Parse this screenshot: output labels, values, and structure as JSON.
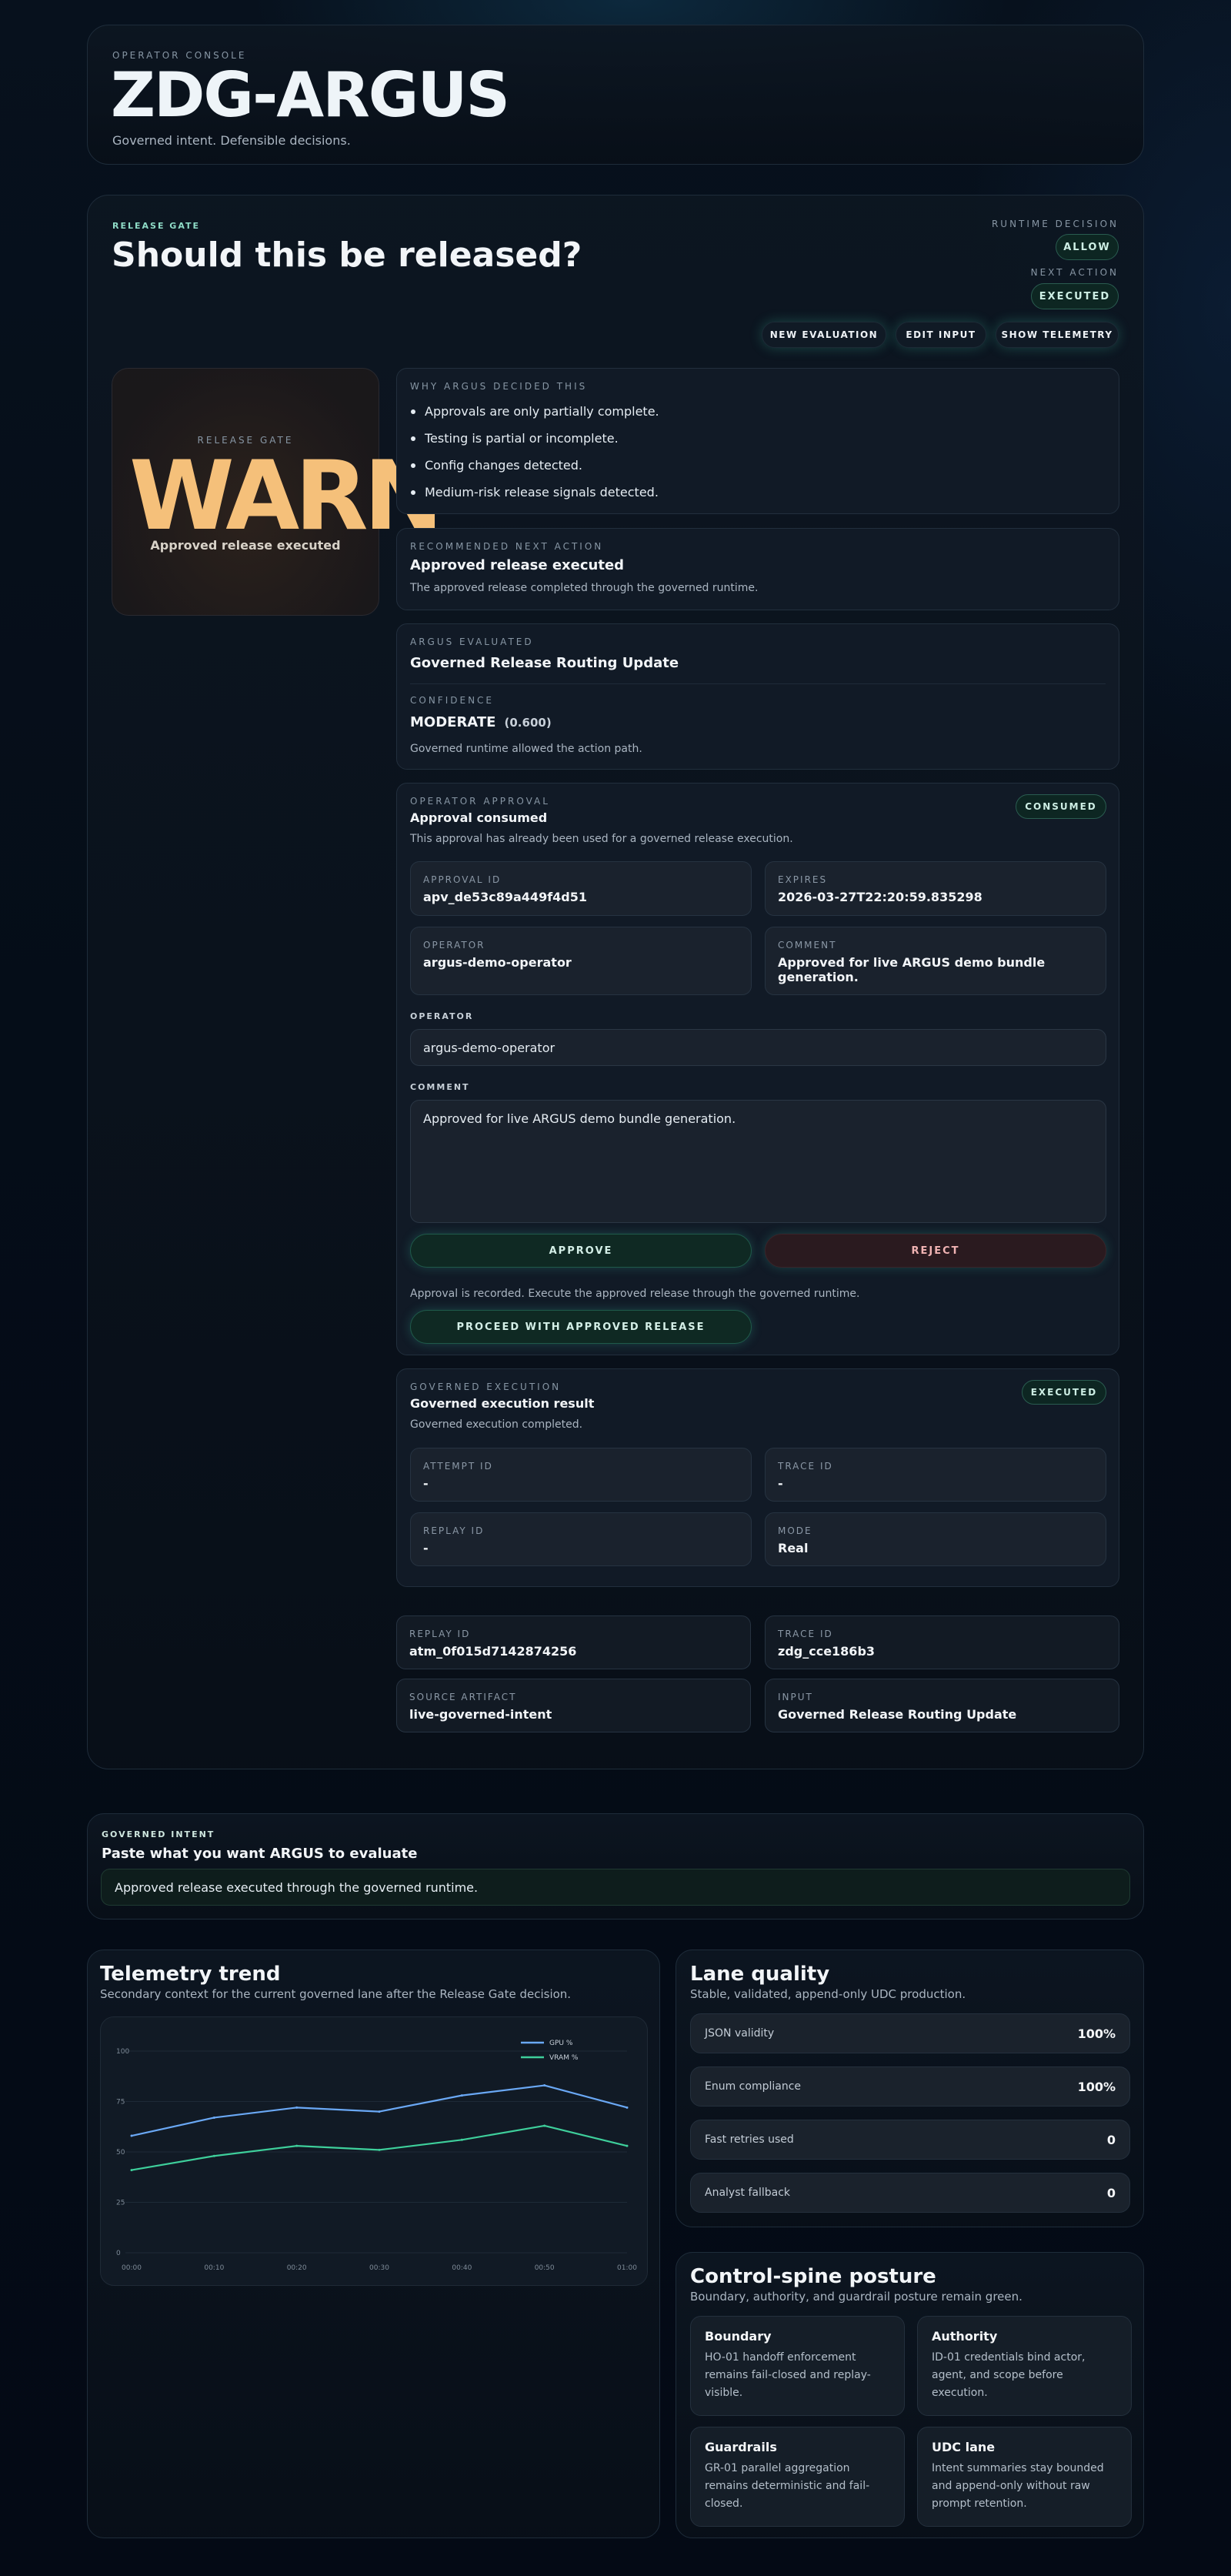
{
  "header": {
    "eyebrow": "OPERATOR CONSOLE",
    "title": "ZDG-ARGUS",
    "tagline": "Governed intent. Defensible decisions."
  },
  "release": {
    "eyebrow": "RELEASE GATE",
    "title": "Should this be released?",
    "runtime_decision_label": "RUNTIME DECISION",
    "runtime_decision": "ALLOW",
    "next_action_label": "NEXT ACTION",
    "next_action": "EXECUTED",
    "buttons": {
      "new_evaluation": "NEW EVALUATION",
      "edit_input": "EDIT INPUT",
      "show_telemetry": "SHOW TELEMETRY"
    },
    "gate": {
      "label": "RELEASE GATE",
      "status": "WARN",
      "caption": "Approved release executed"
    },
    "why": {
      "label": "WHY ARGUS DECIDED THIS",
      "items": [
        "Approvals are only partially complete.",
        "Testing is partial or incomplete.",
        "Config changes detected.",
        "Medium-risk release signals detected."
      ]
    },
    "next": {
      "label": "RECOMMENDED NEXT ACTION",
      "title": "Approved release executed",
      "desc": "The approved release completed through the governed runtime."
    },
    "evaluated": {
      "label": "ARGUS EVALUATED",
      "value": "Governed Release Routing Update",
      "confidence_label": "CONFIDENCE",
      "confidence": "MODERATE",
      "confidence_score": "(0.600)",
      "note": "Governed runtime allowed the action path."
    },
    "approval": {
      "label": "OPERATOR APPROVAL",
      "title": "Approval consumed",
      "badge": "CONSUMED",
      "desc": "This approval has already been used for a governed release execution.",
      "approval_id_label": "APPROVAL ID",
      "approval_id": "apv_de53c89a449f4d51",
      "expires_label": "EXPIRES",
      "expires": "2026-03-27T22:20:59.835298",
      "operator_label": "OPERATOR",
      "operator": "argus-demo-operator",
      "comment_label": "COMMENT",
      "comment": "Approved for live ARGUS demo bundle generation.",
      "operator_field_label": "OPERATOR",
      "operator_field_value": "argus-demo-operator",
      "comment_field_label": "COMMENT",
      "comment_field_value": "Approved for live ARGUS demo bundle generation.",
      "approve": "APPROVE",
      "reject": "REJECT",
      "recorded_note": "Approval is recorded. Execute the approved release through the governed runtime.",
      "proceed": "PROCEED WITH APPROVED RELEASE"
    },
    "execution": {
      "label": "GOVERNED EXECUTION",
      "title": "Governed execution result",
      "badge": "EXECUTED",
      "desc": "Governed execution completed.",
      "attempt_label": "ATTEMPT ID",
      "attempt": "-",
      "trace_label": "TRACE ID",
      "trace": "-",
      "replay_label": "REPLAY ID",
      "replay": "-",
      "mode_label": "MODE",
      "mode": "Real"
    },
    "meta": {
      "replay_label": "REPLAY ID",
      "replay": "atm_0f015d7142874256",
      "trace_label": "TRACE ID",
      "trace": "zdg_cce186b3",
      "source_label": "SOURCE ARTIFACT",
      "source": "live-governed-intent",
      "input_label": "INPUT",
      "input": "Governed Release Routing Update"
    }
  },
  "intent": {
    "eyebrow": "GOVERNED INTENT",
    "title": "Paste what you want ARGUS to evaluate",
    "value": "Approved release executed through the governed runtime."
  },
  "telemetry": {
    "title": "Telemetry trend",
    "subtitle": "Secondary context for the current governed lane after the Release Gate decision."
  },
  "chart_data": {
    "type": "line",
    "x": [
      "00:00",
      "00:10",
      "00:20",
      "00:30",
      "00:40",
      "00:50",
      "01:00"
    ],
    "ylim": [
      0,
      100
    ],
    "yticks": [
      0,
      25,
      50,
      75,
      100
    ],
    "grid": true,
    "legend": "top-right",
    "series": [
      {
        "name": "GPU %",
        "values": [
          58,
          67,
          72,
          70,
          78,
          83,
          72
        ],
        "color": "#6aa8f5"
      },
      {
        "name": "VRAM %",
        "values": [
          41,
          48,
          53,
          51,
          56,
          63,
          53
        ],
        "color": "#3ecf9b"
      }
    ]
  },
  "lane": {
    "title": "Lane quality",
    "subtitle": "Stable, validated, append-only UDC production.",
    "rows": [
      {
        "label": "JSON validity",
        "value": "100%"
      },
      {
        "label": "Enum compliance",
        "value": "100%"
      },
      {
        "label": "Fast retries used",
        "value": "0"
      },
      {
        "label": "Analyst fallback",
        "value": "0"
      }
    ]
  },
  "spine": {
    "title": "Control-spine posture",
    "subtitle": "Boundary, authority, and guardrail posture remain green.",
    "tiles": [
      {
        "title": "Boundary",
        "desc": "HO-01 handoff enforcement remains fail-closed and replay-visible."
      },
      {
        "title": "Authority",
        "desc": "ID-01 credentials bind actor, agent, and scope before execution."
      },
      {
        "title": "Guardrails",
        "desc": "GR-01 parallel aggregation remains deterministic and fail-closed."
      },
      {
        "title": "UDC lane",
        "desc": "Intent summaries stay bounded and append-only without raw prompt retention."
      }
    ]
  },
  "colors": {
    "accent": "#8fdcc7",
    "warn": "#f5c07a",
    "reject": "#f0b3b3",
    "background": "#050d18"
  }
}
